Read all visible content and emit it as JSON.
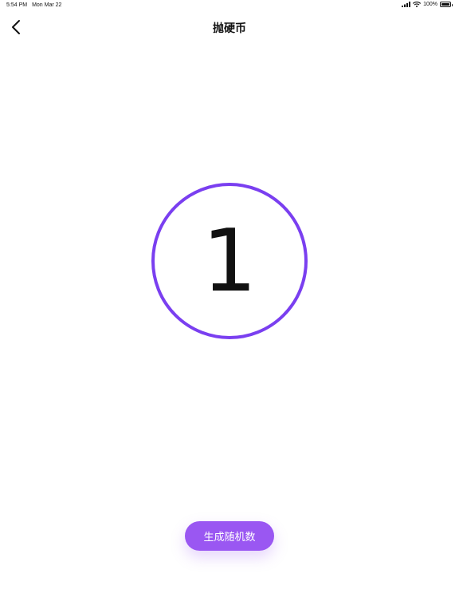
{
  "status_bar": {
    "time": "5:54 PM",
    "date": "Mon Mar 22",
    "battery_percent": "100%",
    "battery_level": 1.0,
    "signal_icon": "cellular-signal-icon",
    "wifi_icon": "wifi-icon",
    "battery_icon": "battery-icon"
  },
  "nav": {
    "back_icon": "chevron-left-icon",
    "title": "抛硬币"
  },
  "result": {
    "value": "1"
  },
  "actions": {
    "generate_label": "生成随机数"
  },
  "colors": {
    "accent": "#7a3ff0",
    "button": "#9a57f2",
    "text": "#111111",
    "background": "#ffffff"
  }
}
